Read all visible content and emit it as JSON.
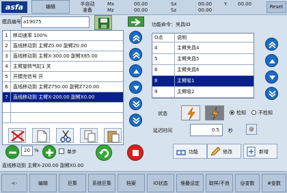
{
  "header": {
    "logo": "asfa",
    "mode": "编辑",
    "status_line1": "半自动",
    "status_line2": "准备",
    "axes": [
      {
        "k": "Mx",
        "v": "00.00"
      },
      {
        "k": "Mz",
        "v": "00.00"
      },
      {
        "k": "Sx",
        "v": "00.00"
      },
      {
        "k": "Sz",
        "v": "00.00"
      },
      {
        "k": "Y",
        "v": "00.00"
      }
    ],
    "reset": "Reset"
  },
  "mold": {
    "label": "模具编号",
    "value": "a19075"
  },
  "program": [
    {
      "n": "1",
      "t": "移动速率 100%"
    },
    {
      "n": "2",
      "t": "直线移动到 主臂Z0.00 副臂Z0.00"
    },
    {
      "n": "3",
      "t": "直线移动到 主臂X-300.00 副臂X85.00"
    },
    {
      "n": "4",
      "t": "主臂旋转气缸1 关"
    },
    {
      "n": "5",
      "t": "开模完信号 开"
    },
    {
      "n": "6",
      "t": "直线移动到 主臂Z750.00 副臂Z720.00"
    },
    {
      "n": "7",
      "t": "直线移动到 主臂X-200.00 副臂X0.00"
    },
    {
      "n": "",
      "t": ""
    },
    {
      "n": "",
      "t": ""
    }
  ],
  "speed": {
    "value": "20",
    "unit": "%",
    "single_step": "单步"
  },
  "func": {
    "label": "功能命令：",
    "value": "夹具IO"
  },
  "io": {
    "headers": [
      "O点",
      "说明"
    ],
    "rows": [
      {
        "n": "4",
        "d": "主臂夹具4"
      },
      {
        "n": "5",
        "d": "主臂夹具5"
      },
      {
        "n": "6",
        "d": "主臂夹具6"
      },
      {
        "n": "8",
        "d": "主臂吸1"
      },
      {
        "n": "9",
        "d": "主臂吸2"
      }
    ]
  },
  "state": {
    "label": "状态",
    "detect": "检知",
    "no_detect": "不检知"
  },
  "delay": {
    "label": "延迟时间",
    "value": "0.5",
    "unit": "秒",
    "at": "@"
  },
  "actions": {
    "func": "功能",
    "modify": "修改",
    "add": "新增"
  },
  "status_text": "直线移动到 主臂X-200.00 副臂X0.00",
  "menu": [
    "<-",
    "编辑",
    "巨集",
    "系统巨集",
    "档案",
    "IO状态",
    "堆叠设定",
    "取样/不良",
    "@变数",
    "#变数"
  ]
}
